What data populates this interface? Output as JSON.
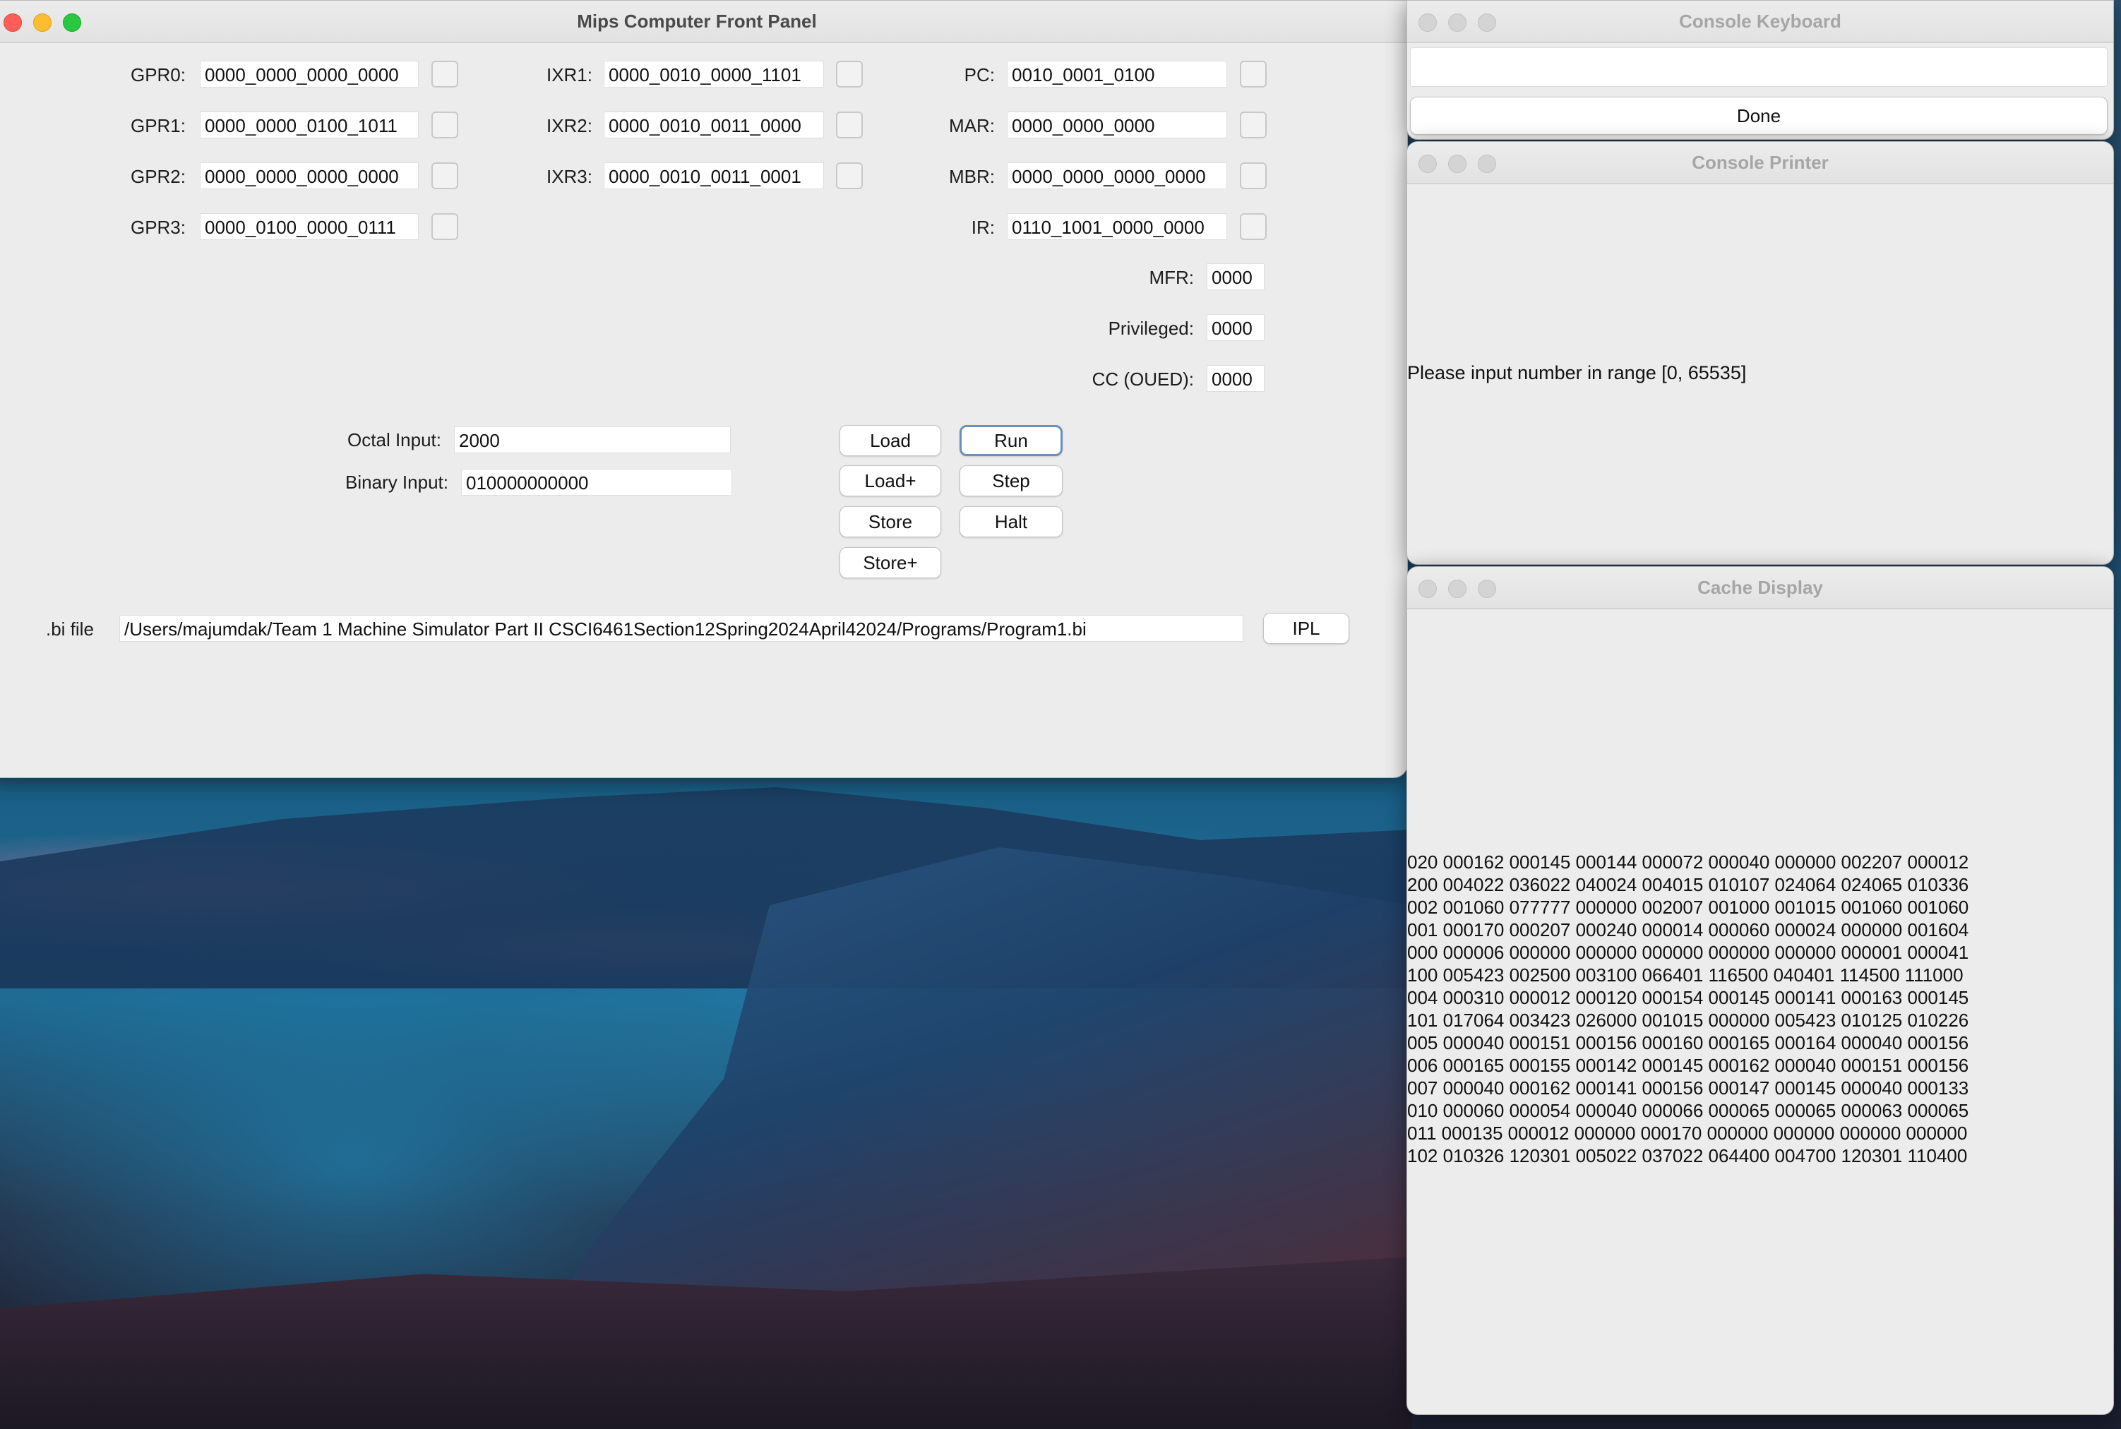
{
  "front_panel": {
    "title": "Mips Computer Front Panel",
    "gpr": [
      {
        "label": "GPR0:",
        "value": "0000_0000_0000_0000"
      },
      {
        "label": "GPR1:",
        "value": "0000_0000_0100_1011"
      },
      {
        "label": "GPR2:",
        "value": "0000_0000_0000_0000"
      },
      {
        "label": "GPR3:",
        "value": "0000_0100_0000_0111"
      }
    ],
    "ixr": [
      {
        "label": "IXR1:",
        "value": "0000_0010_0000_1101"
      },
      {
        "label": "IXR2:",
        "value": "0000_0010_0011_0000"
      },
      {
        "label": "IXR3:",
        "value": "0000_0010_0011_0001"
      }
    ],
    "special": [
      {
        "label": "PC:",
        "value": "0010_0001_0100"
      },
      {
        "label": "MAR:",
        "value": "0000_0000_0000"
      },
      {
        "label": "MBR:",
        "value": "0000_0000_0000_0000"
      },
      {
        "label": "IR:",
        "value": "0110_1001_0000_0000"
      }
    ],
    "flags": [
      {
        "label": "MFR:",
        "value": "0000"
      },
      {
        "label": "Privileged:",
        "value": "0000"
      },
      {
        "label": "CC (OUED):",
        "value": "0000"
      }
    ],
    "octal_input": {
      "label": "Octal Input:",
      "value": "2000"
    },
    "binary_input": {
      "label": "Binary Input:",
      "value": "010000000000"
    },
    "buttons": {
      "load": "Load",
      "run": "Run",
      "load_plus": "Load+",
      "step": "Step",
      "store": "Store",
      "halt": "Halt",
      "store_plus": "Store+",
      "ipl": "IPL"
    },
    "bi_file": {
      "label": ".bi file",
      "path": "/Users/majumdak/Team 1 Machine Simulator Part II CSCI6461Section12Spring2024April42024/Programs/Program1.bi"
    }
  },
  "console_keyboard": {
    "title": "Console Keyboard",
    "input_value": "",
    "done_label": "Done"
  },
  "console_printer": {
    "title": "Console Printer",
    "message": "Please input number in range [0, 65535]"
  },
  "cache_display": {
    "title": "Cache Display",
    "lines": [
      "020 000162 000145 000144 000072 000040 000000 002207 000012",
      "200 004022 036022 040024 004015 010107 024064 024065 010336",
      "002 001060 077777 000000 002007 001000 001015 001060 001060",
      "001 000170 000207 000240 000014 000060 000024 000000 001604",
      "000 000006 000000 000000 000000 000000 000000 000001 000041",
      "100 005423 002500 003100 066401 116500 040401 114500 111000",
      "004 000310 000012 000120 000154 000145 000141 000163 000145",
      "101 017064 003423 026000 001015 000000 005423 010125 010226",
      "005 000040 000151 000156 000160 000165 000164 000040 000156",
      "006 000165 000155 000142 000145 000162 000040 000151 000156",
      "007 000040 000162 000141 000156 000147 000145 000040 000133",
      "010 000060 000054 000040 000066 000065 000065 000063 000065",
      "011 000135 000012 000000 000170 000000 000000 000000 000000",
      "102 010326 120301 005022 037022 064400 004700 120301 110400"
    ]
  }
}
